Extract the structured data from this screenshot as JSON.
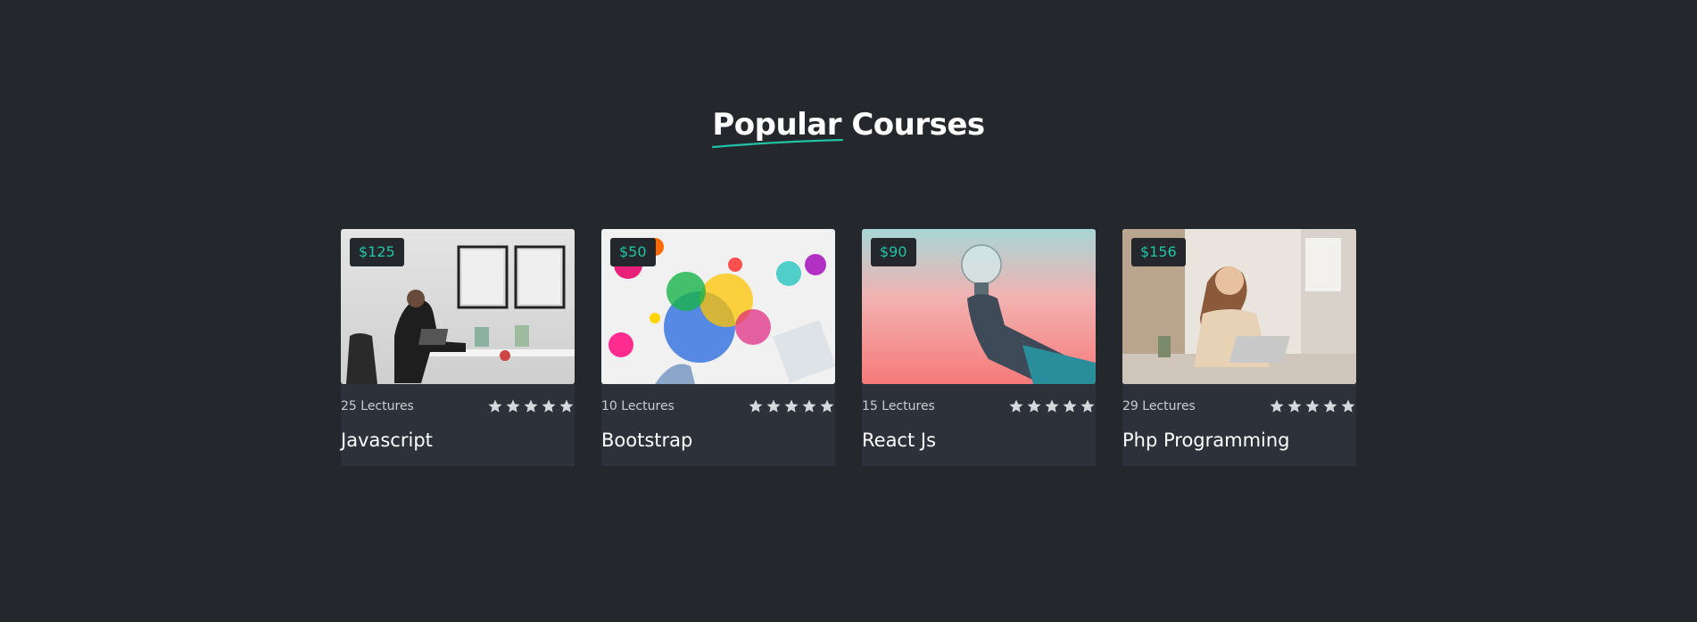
{
  "section": {
    "title": "Popular Courses",
    "accent_color": "#20c4a4"
  },
  "courses": [
    {
      "price": "$125",
      "lectures": "25 Lectures",
      "name": "Javascript",
      "rating": 5,
      "image": "man-at-desk-photo"
    },
    {
      "price": "$50",
      "lectures": "10 Lectures",
      "name": "Bootstrap",
      "rating": 5,
      "image": "paint-splashes-photo"
    },
    {
      "price": "$90",
      "lectures": "15 Lectures",
      "name": "React Js",
      "rating": 5,
      "image": "lightbulb-hand-photo"
    },
    {
      "price": "$156",
      "lectures": "29 Lectures",
      "name": "Php Programming",
      "rating": 5,
      "image": "woman-with-laptop-photo"
    }
  ]
}
